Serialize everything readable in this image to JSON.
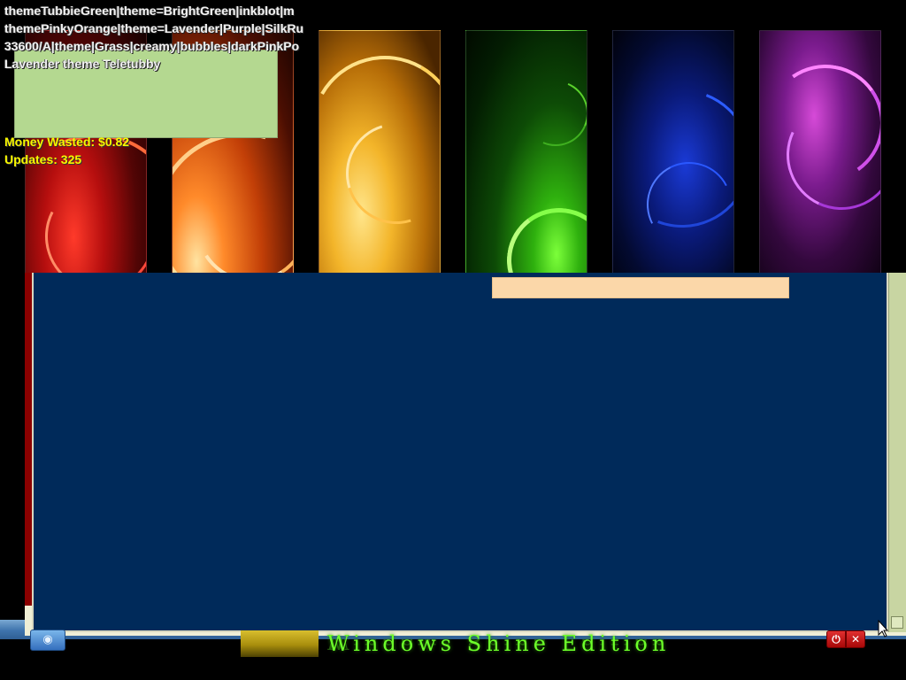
{
  "overlay": {
    "theme_lines": [
      "themeTubbieGreen|theme=BrightGreen|inkblot|m",
      "themePinkyOrange|theme=Lavender|Purple|SilkRu",
      "33600/A|theme|Grass|creamy|bubbles|darkPinkPo",
      "Lavender theme Teletubby"
    ]
  },
  "stats": {
    "money_wasted_label": "Money Wasted: $0.82",
    "updates_label": "Updates: 325"
  },
  "taskbar": {
    "start_glyph": "◉"
  },
  "branding": {
    "title": "Windows Shine Edition"
  },
  "tray": {
    "power_glyph": "⏻",
    "close_glyph": "✕"
  },
  "icons": {
    "start": "start-orb-icon",
    "power": "power-icon",
    "close": "close-icon",
    "cursor": "mouse-pointer-icon"
  },
  "colors": {
    "panel_blue": "#002a5a",
    "overlay_green": "#b4d890",
    "peach_bar": "#fbd7a9",
    "stats_yellow": "#f7f700",
    "brand_green": "#6dff2a",
    "taskbar_blue": "#3f74ad"
  }
}
